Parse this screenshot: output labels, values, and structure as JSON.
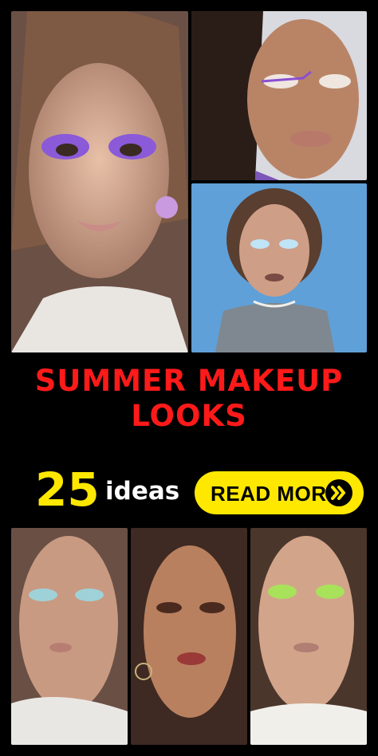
{
  "headline": {
    "line1": "SUMMER MAKEUP",
    "line2": "LOOKS"
  },
  "count": {
    "number": "25",
    "label": "ideas"
  },
  "cta": {
    "label": "READ MORE",
    "icon": "double-chevron-right-icon"
  },
  "colors": {
    "background": "#000000",
    "headline": "#ff1a1a",
    "accent": "#ffe800",
    "ideas_text": "#ffffff"
  }
}
